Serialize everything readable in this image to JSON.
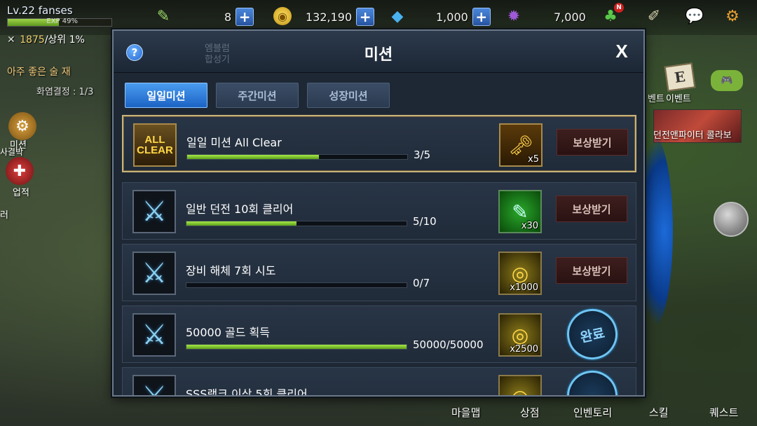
{
  "player": {
    "level": "Lv.22",
    "name": "fanses",
    "exp": "EXP 49%",
    "exp_fraction": 0.49,
    "rank_value": "1875",
    "rank_pct": "/상위 1%"
  },
  "currency": {
    "stamina": "8",
    "gold": "132,190",
    "gems": "1,000",
    "crystals": "7,000"
  },
  "left": {
    "quest_title": "아주 좋은 술 재",
    "quest_sub": "화염결정 : 1/3",
    "emblem": "엠블럼",
    "synth": "합성기",
    "buy": "사결박",
    "mission": "미션",
    "achievement": "업적",
    "left_er": "러"
  },
  "right": {
    "event": "벤트",
    "event2": "이벤트",
    "collab": "던전앤파이터 콜라보",
    "notify_badge": "N"
  },
  "bottom_menu": [
    "마을맵",
    "상점",
    "인벤토리",
    "스킬",
    "퀘스트"
  ],
  "dialog": {
    "title": "미션",
    "close": "X",
    "help": "?",
    "tabs": [
      {
        "label": "일일미션",
        "active": true
      },
      {
        "label": "주간미션",
        "active": false
      },
      {
        "label": "성장미션",
        "active": false
      }
    ],
    "missions": [
      {
        "icon": "ALL CLEAR",
        "title": "일일 미션 All Clear",
        "progress": "3/5",
        "fraction": 0.6,
        "reward_qty": "x5",
        "reward_icon": "golden-key",
        "button": "보상받기",
        "state": "claim"
      },
      {
        "icon": "swords",
        "title": "일반 던전 10회 클리어",
        "progress": "5/10",
        "fraction": 0.5,
        "reward_qty": "x30",
        "reward_icon": "stamina-potion",
        "button": "보상받기",
        "state": "claim"
      },
      {
        "icon": "swords",
        "title": "장비 해체 7회 시도",
        "progress": "0/7",
        "fraction": 0.0,
        "reward_qty": "x1000",
        "reward_icon": "gold-coins",
        "button": "보상받기",
        "state": "claim"
      },
      {
        "icon": "swords",
        "title": "50000 골드 획득",
        "progress": "50000/50000",
        "fraction": 1.0,
        "reward_qty": "x2500",
        "reward_icon": "gold-coins",
        "button": "완료",
        "state": "done"
      },
      {
        "icon": "swords",
        "title": "SSS랭크 이상 5회 클리어",
        "progress": "",
        "fraction": 0.0,
        "reward_qty": "",
        "reward_icon": "gold-coins",
        "button": "",
        "state": "done"
      }
    ]
  }
}
